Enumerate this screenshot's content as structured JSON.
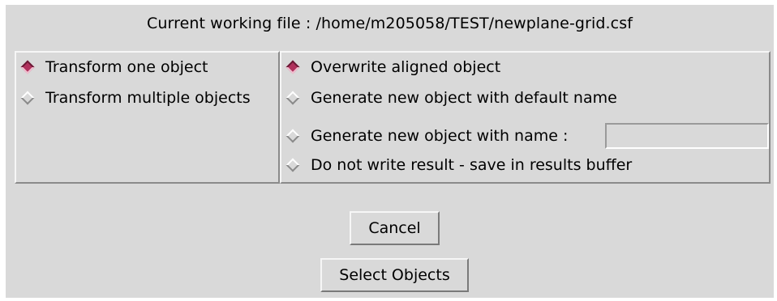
{
  "header": {
    "title": "Current working file : /home/m205058/TEST/newplane-grid.csf"
  },
  "transform_mode": {
    "options": [
      {
        "label": "Transform one object",
        "selected": true
      },
      {
        "label": "Transform multiple objects",
        "selected": false
      }
    ]
  },
  "output_mode": {
    "options": [
      {
        "label": "Overwrite aligned object",
        "selected": true
      },
      {
        "label": "Generate new object with default name",
        "selected": false
      },
      {
        "label": "Generate new object with name :",
        "selected": false
      },
      {
        "label": "Do not write result - save in results buffer",
        "selected": false
      }
    ],
    "name_field_value": ""
  },
  "buttons": {
    "cancel_label": "Cancel",
    "select_label": "Select Objects"
  },
  "colors": {
    "background": "#d9d9d9",
    "radio_selected": "#b0305c"
  }
}
